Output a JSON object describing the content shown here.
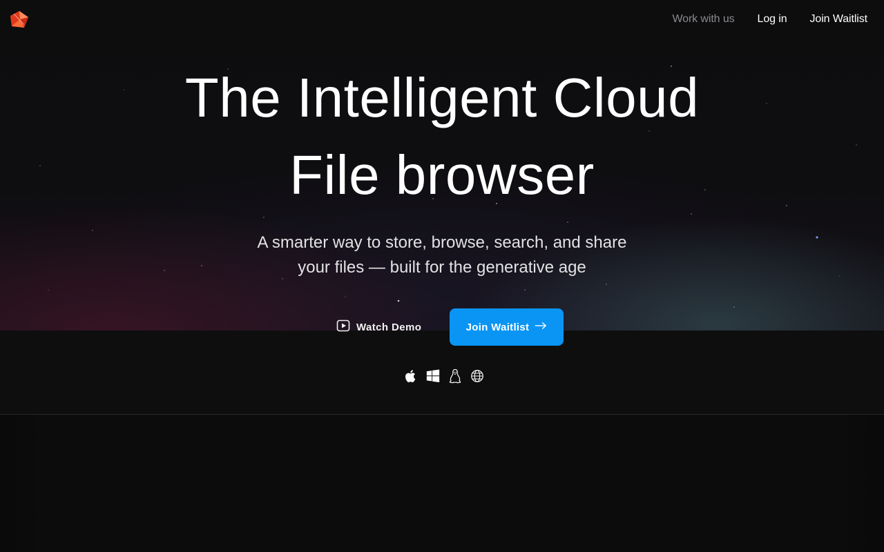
{
  "nav": {
    "logo_icon": "cube-logo-icon",
    "links": [
      {
        "label": "Work with us",
        "muted": true
      },
      {
        "label": "Log in",
        "muted": false
      },
      {
        "label": "Join Waitlist",
        "muted": false
      }
    ]
  },
  "hero": {
    "headline_line1": "The Intelligent Cloud",
    "headline_line2": "File browser",
    "subhead_line1": "A smarter way to store, browse, search, and share",
    "subhead_line2": "your files — built for the generative age"
  },
  "cta": {
    "watch_demo_label": "Watch Demo",
    "watch_demo_icon": "play-icon",
    "join_label": "Join Waitlist",
    "join_icon": "arrow-right-icon"
  },
  "platforms": [
    "apple-icon",
    "windows-icon",
    "linux-icon",
    "globe-icon"
  ],
  "colors": {
    "accent": "#0a95f5",
    "background": "#0c0c0d",
    "logo_orange": "#ff5a2a"
  }
}
